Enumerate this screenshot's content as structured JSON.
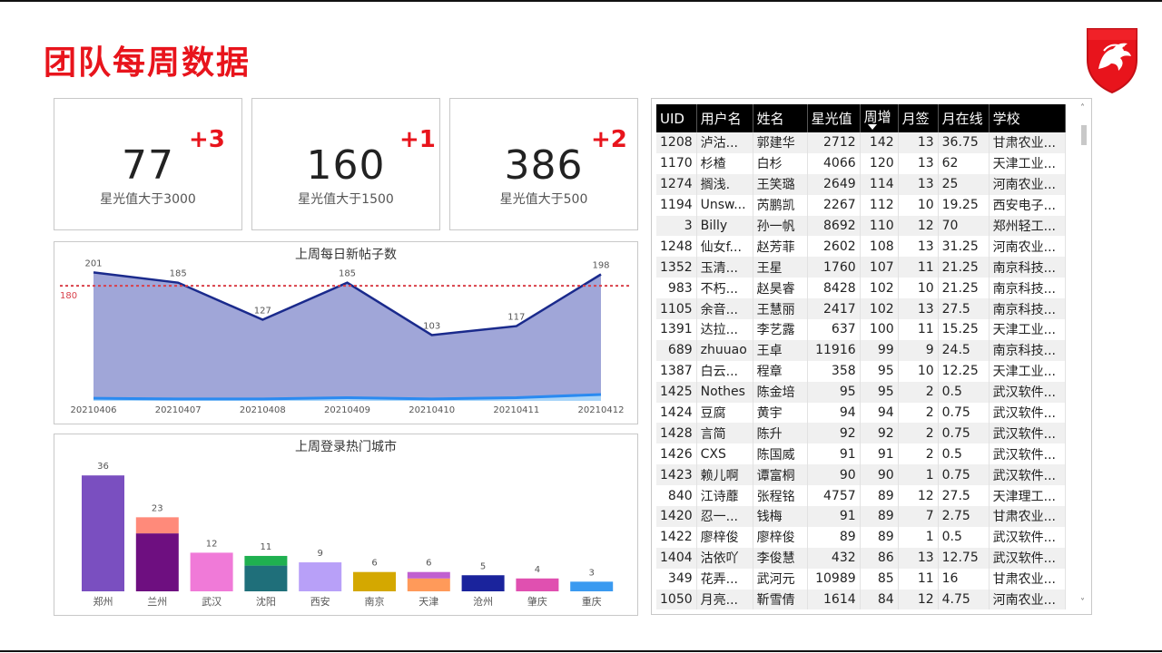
{
  "page": {
    "title": "团队每周数据"
  },
  "logo": {
    "icon": "dragon-shield-logo",
    "color": "#e8141c"
  },
  "kpis": [
    {
      "value": "77",
      "delta": "+3",
      "label": "星光值大于3000"
    },
    {
      "value": "160",
      "delta": "+1",
      "label": "星光值大于1500"
    },
    {
      "value": "386",
      "delta": "+2",
      "label": "星光值大于500"
    }
  ],
  "line_chart": {
    "title": "上周每日新帖子数"
  },
  "bar_chart": {
    "title": "上周登录热门城市"
  },
  "chart_data": [
    {
      "type": "area",
      "title": "上周每日新帖子数",
      "categories": [
        "20210406",
        "20210407",
        "20210408",
        "20210409",
        "20210410",
        "20210411",
        "20210412"
      ],
      "series": [
        {
          "values": [
            201,
            185,
            127,
            185,
            103,
            117,
            198
          ],
          "color": "#1a2a8c",
          "fill": "#a0a6d8"
        },
        {
          "values": [
            4,
            3,
            3,
            5,
            3,
            5,
            10
          ],
          "color": "#2a8af0",
          "fill": "#a8d4f8"
        }
      ],
      "reference_line": {
        "value": 180,
        "label": "180",
        "color": "#d9404a",
        "style": "dotted"
      },
      "ylim": [
        0,
        220
      ],
      "data_labels": true,
      "grid": false
    },
    {
      "type": "bar",
      "title": "上周登录热门城市",
      "categories": [
        "郑州",
        "兰州",
        "武汉",
        "沈阳",
        "西安",
        "南京",
        "天津",
        "沧州",
        "肇庆",
        "重庆"
      ],
      "values": [
        36,
        23,
        12,
        11,
        9,
        6,
        6,
        5,
        4,
        3
      ],
      "segments": [
        [
          {
            "value": 36,
            "color": "#7a4fc0"
          }
        ],
        [
          {
            "value": 18,
            "color": "#6e0f80"
          },
          {
            "value": 5,
            "color": "#ff8a7a"
          }
        ],
        [
          {
            "value": 12,
            "color": "#f07ad8"
          }
        ],
        [
          {
            "value": 8,
            "color": "#1f6f7a"
          },
          {
            "value": 3,
            "color": "#1fb050"
          }
        ],
        [
          {
            "value": 9,
            "color": "#b8a0f8"
          }
        ],
        [
          {
            "value": 6,
            "color": "#d4a800"
          }
        ],
        [
          {
            "value": 4,
            "color": "#ff9a5a"
          },
          {
            "value": 2,
            "color": "#c060d0"
          }
        ],
        [
          {
            "value": 5,
            "color": "#1a239c"
          }
        ],
        [
          {
            "value": 4,
            "color": "#e050b0"
          }
        ],
        [
          {
            "value": 3,
            "color": "#3a9af0"
          }
        ]
      ],
      "ylim": [
        0,
        40
      ],
      "data_labels": true,
      "grid": false
    }
  ],
  "table": {
    "columns": [
      "UID",
      "用户名",
      "姓名",
      "星光值",
      "周增",
      "月签",
      "月在线",
      "学校"
    ],
    "sorted_column": "周增",
    "rows": [
      [
        "1208",
        "泸沽...",
        "郭建华",
        "2712",
        "142",
        "13",
        "36.75",
        "甘肃农业..."
      ],
      [
        "1170",
        "杉楂",
        "白杉",
        "4066",
        "120",
        "13",
        "62",
        "天津工业..."
      ],
      [
        "1274",
        "搁浅.",
        "王笑璐",
        "2649",
        "114",
        "13",
        "25",
        "河南农业..."
      ],
      [
        "1194",
        "Unsw...",
        "芮鹏凯",
        "2267",
        "112",
        "10",
        "19.25",
        "西安电子..."
      ],
      [
        "3",
        "Billy",
        "孙一帆",
        "8692",
        "110",
        "12",
        "70",
        "郑州轻工..."
      ],
      [
        "1248",
        "仙女f...",
        "赵芳菲",
        "2602",
        "108",
        "13",
        "31.25",
        "河南农业..."
      ],
      [
        "1352",
        "玉清...",
        "王星",
        "1760",
        "107",
        "11",
        "21.25",
        "南京科技..."
      ],
      [
        "983",
        "不朽...",
        "赵昊睿",
        "8428",
        "102",
        "10",
        "21.25",
        "南京科技..."
      ],
      [
        "1105",
        "余音...",
        "王慧丽",
        "2417",
        "102",
        "13",
        "27.5",
        "南京科技..."
      ],
      [
        "1391",
        "达拉...",
        "李艺露",
        "637",
        "100",
        "11",
        "15.25",
        "天津工业..."
      ],
      [
        "689",
        "zhuuao",
        "王卓",
        "11916",
        "99",
        "9",
        "24.5",
        "南京科技..."
      ],
      [
        "1387",
        "白云...",
        "程章",
        "358",
        "95",
        "10",
        "12.25",
        "天津工业..."
      ],
      [
        "1425",
        "Nothes",
        "陈金培",
        "95",
        "95",
        "2",
        "0.5",
        "武汉软件..."
      ],
      [
        "1424",
        "豆腐",
        "黄宇",
        "94",
        "94",
        "2",
        "0.75",
        "武汉软件..."
      ],
      [
        "1428",
        "言简",
        "陈升",
        "92",
        "92",
        "2",
        "0.75",
        "武汉软件..."
      ],
      [
        "1426",
        "CXS",
        "陈国威",
        "91",
        "91",
        "2",
        "0.5",
        "武汉软件..."
      ],
      [
        "1423",
        "赖儿啊",
        "谭富桐",
        "90",
        "90",
        "1",
        "0.75",
        "武汉软件..."
      ],
      [
        "840",
        "江诗蘼",
        "张程铭",
        "4757",
        "89",
        "12",
        "27.5",
        "天津理工..."
      ],
      [
        "1420",
        "忍一...",
        "钱梅",
        "91",
        "89",
        "7",
        "2.75",
        "甘肃农业..."
      ],
      [
        "1422",
        "廖梓俊",
        "廖梓俊",
        "89",
        "89",
        "1",
        "0.5",
        "武汉软件..."
      ],
      [
        "1404",
        "沽依吖",
        "李俊慧",
        "432",
        "86",
        "13",
        "12.75",
        "武汉软件..."
      ],
      [
        "349",
        "花弄...",
        "武河元",
        "10989",
        "85",
        "11",
        "16",
        "甘肃农业..."
      ],
      [
        "1050",
        "月亮...",
        "靳雪倩",
        "1614",
        "84",
        "12",
        "4.75",
        "河南农业..."
      ]
    ]
  }
}
